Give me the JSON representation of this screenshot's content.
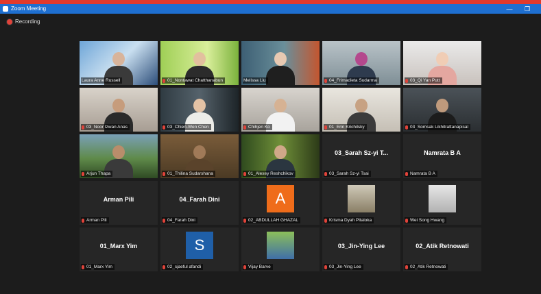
{
  "window": {
    "title": "Zoom Meeting",
    "minimize_glyph": "—",
    "restore_glyph": "❐"
  },
  "status": {
    "recording_label": "Recording"
  },
  "colors": {
    "titlebar": "#1e6fd0",
    "record_red": "#e0433a",
    "active_speaker_border": "#d8d56b"
  },
  "participants": [
    {
      "label": "Laura Anne Russell",
      "muted": false
    },
    {
      "label": "01_Nontawat Chatthanabun",
      "muted": true
    },
    {
      "label": "Melissa Liu",
      "muted": false
    },
    {
      "label": "04_Frimadieta Sudarma",
      "muted": true
    },
    {
      "label": "03_Qi Yan Putt",
      "muted": true
    },
    {
      "label": "03_Noor Izwan Anas",
      "muted": true
    },
    {
      "label": "03_Chien-Wen Chen",
      "muted": true
    },
    {
      "label": "Chihjen Ko",
      "muted": true
    },
    {
      "label": "01_Erin Krichilsky",
      "muted": true
    },
    {
      "label": "03_Somsak Likhitrattanapisal",
      "muted": true
    },
    {
      "label": "Arjun Thapa",
      "muted": true
    },
    {
      "label": "01_Thilina Sudarshana",
      "muted": true
    },
    {
      "label": "01_Alexey Reshchikov",
      "muted": true
    },
    {
      "label": "03_Sarah Sz-yi Tsai",
      "display": "03_Sarah Sz-yi T...",
      "muted": true
    },
    {
      "label": "Namrata B A",
      "display": "Namrata B A",
      "muted": true
    },
    {
      "label": "Arman Pili",
      "display": "Arman Pili",
      "muted": true
    },
    {
      "label": "04_Farah Dini",
      "display": "04_Farah Dini",
      "muted": true
    },
    {
      "label": "02_ABDULLAH GHAZAL",
      "avatar_letter": "A",
      "muted": true
    },
    {
      "label": "Krisma Dyah Pitaloka",
      "muted": true
    },
    {
      "label": "Wei Song Hwang",
      "muted": true
    },
    {
      "label": "01_Marx Yim",
      "display": "01_Marx Yim",
      "muted": true
    },
    {
      "label": "02_sjaeful afandi",
      "avatar_letter": "S",
      "muted": true
    },
    {
      "label": "Vijay Barve",
      "muted": true
    },
    {
      "label": "03_Jin-Ying Lee",
      "display": "03_Jin-Ying Lee",
      "muted": true
    },
    {
      "label": "02_Atik Retnowati",
      "display": "02_Atik Retnowati",
      "muted": true
    }
  ]
}
